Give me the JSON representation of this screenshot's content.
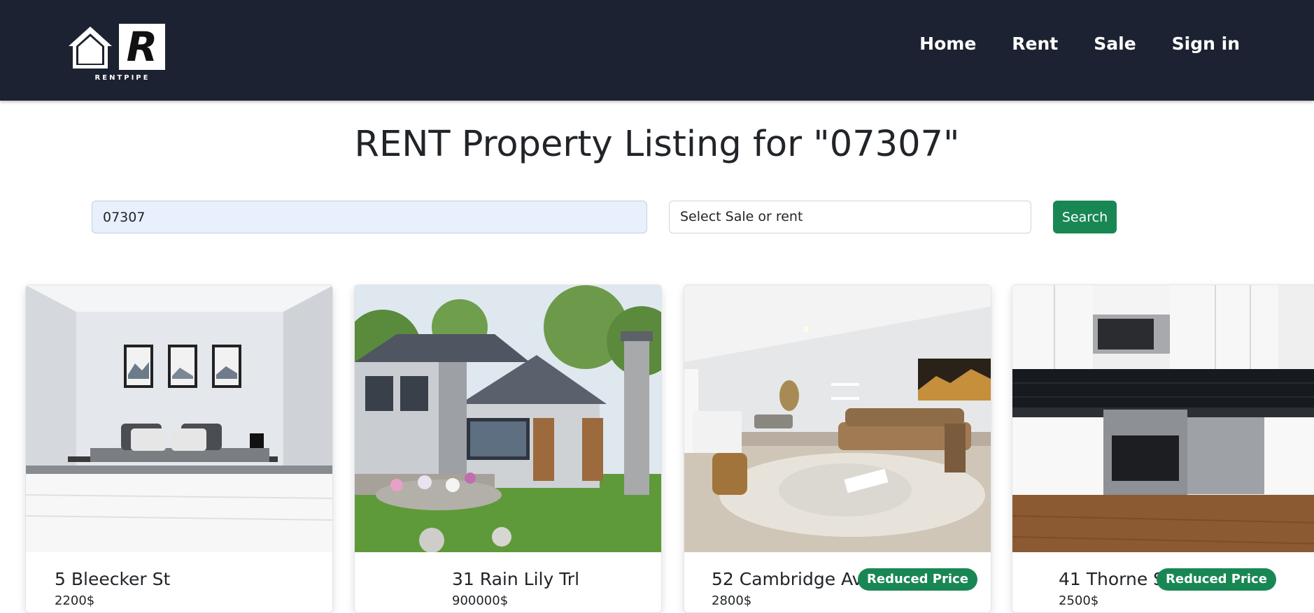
{
  "brand": {
    "logo_letter": "R",
    "logo_text": "RENTPIPE"
  },
  "nav": {
    "items": [
      {
        "label": "Home"
      },
      {
        "label": "Rent"
      },
      {
        "label": "Sale"
      },
      {
        "label": "Sign in"
      }
    ]
  },
  "page": {
    "title": "RENT Property Listing for \"07307\""
  },
  "search": {
    "value": "07307",
    "select_label": "Select Sale or rent",
    "button_label": "Search"
  },
  "listings": [
    {
      "address": "5 Bleecker St",
      "price": "2200$",
      "badge": ""
    },
    {
      "address": "31 Rain Lily Trl",
      "price": "900000$",
      "badge": ""
    },
    {
      "address": "52 Cambridge Ave",
      "price": "2800$",
      "badge": "Reduced Price"
    },
    {
      "address": "41 Thorne St",
      "price": "2500$",
      "badge": "Reduced Price"
    }
  ],
  "colors": {
    "navbar": "#1c2231",
    "accent": "#198754",
    "input_bg": "#e8f0fe"
  }
}
